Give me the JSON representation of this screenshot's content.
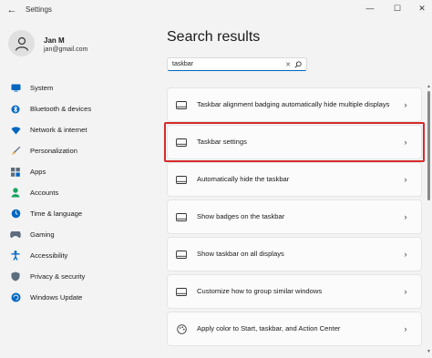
{
  "window": {
    "title": "Settings",
    "back_glyph": "←",
    "minimize_glyph": "—",
    "maximize_glyph": "☐",
    "close_glyph": "✕"
  },
  "user": {
    "name": "Jan M",
    "email": "jan@gmail.com"
  },
  "sidebar": {
    "items": [
      {
        "label": "System",
        "icon": "monitor-icon",
        "color": "#0067c0"
      },
      {
        "label": "Bluetooth & devices",
        "icon": "bluetooth-icon",
        "color": "#0067c0"
      },
      {
        "label": "Network & internet",
        "icon": "wifi-icon",
        "color": "#0067c0"
      },
      {
        "label": "Personalization",
        "icon": "brush-icon",
        "color": "#e8a23a"
      },
      {
        "label": "Apps",
        "icon": "apps-icon",
        "color": "#5c6d7e"
      },
      {
        "label": "Accounts",
        "icon": "person-icon",
        "color": "#1aa260"
      },
      {
        "label": "Time & language",
        "icon": "globe-clock-icon",
        "color": "#0067c0"
      },
      {
        "label": "Gaming",
        "icon": "gamepad-icon",
        "color": "#5c6d7e"
      },
      {
        "label": "Accessibility",
        "icon": "accessibility-icon",
        "color": "#0067c0"
      },
      {
        "label": "Privacy & security",
        "icon": "shield-icon",
        "color": "#5c6d7e"
      },
      {
        "label": "Windows Update",
        "icon": "update-icon",
        "color": "#0067c0"
      }
    ]
  },
  "main": {
    "title": "Search results",
    "search": {
      "value": "taskbar",
      "clear_glyph": "✕"
    },
    "results": [
      {
        "label": "Taskbar alignment badging automatically hide multiple displays",
        "icon": "taskbar-icon"
      },
      {
        "label": "Taskbar settings",
        "icon": "taskbar-icon",
        "highlighted": true
      },
      {
        "label": "Automatically hide the taskbar",
        "icon": "taskbar-icon"
      },
      {
        "label": "Show badges on the taskbar",
        "icon": "taskbar-icon"
      },
      {
        "label": "Show taskbar on all displays",
        "icon": "taskbar-icon"
      },
      {
        "label": "Customize how to group similar windows",
        "icon": "taskbar-icon"
      },
      {
        "label": "Apply color to Start, taskbar, and Action Center",
        "icon": "palette-icon"
      }
    ],
    "chevron_glyph": "›"
  },
  "colors": {
    "accent": "#0067c0",
    "highlight_border": "#d62b2b"
  }
}
